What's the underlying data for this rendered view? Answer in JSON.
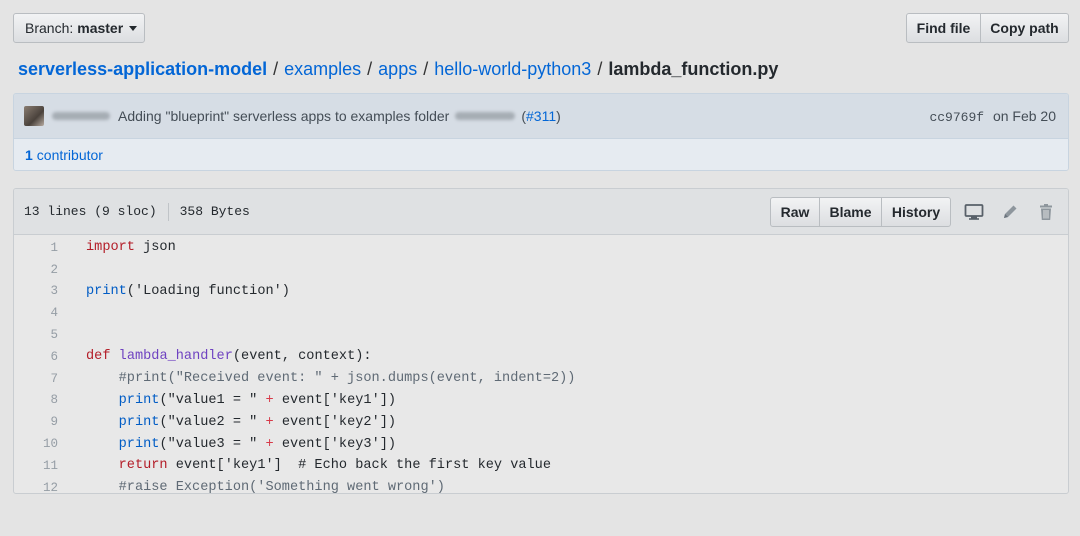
{
  "branch": {
    "label": "Branch:",
    "value": "master"
  },
  "toolbar": {
    "find_file": "Find file",
    "copy_path": "Copy path"
  },
  "breadcrumb": {
    "repo": "serverless-application-model",
    "dirs": [
      "examples",
      "apps",
      "hello-world-python3"
    ],
    "file": "lambda_function.py",
    "separator": "/"
  },
  "commit": {
    "message": "Adding \"blueprint\" serverless apps to examples folder",
    "pr": "#311",
    "pr_open": "(",
    "pr_close": ")",
    "sha": "cc9769f",
    "date": "on Feb 20",
    "contributors_count": "1",
    "contributors_label": "contributor"
  },
  "file": {
    "lines_info": "13 lines (9 sloc)",
    "size": "358 Bytes",
    "raw": "Raw",
    "blame": "Blame",
    "history": "History"
  },
  "icons": {
    "desktop": "desktop-icon",
    "edit": "pencil-icon",
    "delete": "trash-icon"
  },
  "colors": {
    "link": "#0366d6",
    "keyword": "#d73a49",
    "builtin": "#005cc5",
    "function": "#6f42c1",
    "string": "#032f62"
  },
  "code": [
    {
      "n": "1",
      "tokens": [
        {
          "t": "import",
          "c": "kw"
        },
        {
          "t": " json",
          "c": ""
        }
      ]
    },
    {
      "n": "2",
      "tokens": []
    },
    {
      "n": "3",
      "tokens": [
        {
          "t": "print",
          "c": "bi"
        },
        {
          "t": "('Loading function')",
          "c": ""
        }
      ]
    },
    {
      "n": "4",
      "tokens": []
    },
    {
      "n": "5",
      "tokens": []
    },
    {
      "n": "6",
      "tokens": [
        {
          "t": "def",
          "c": "kw"
        },
        {
          "t": " ",
          "c": ""
        },
        {
          "t": "lambda_handler",
          "c": "fn"
        },
        {
          "t": "(event, context):",
          "c": ""
        }
      ]
    },
    {
      "n": "7",
      "tokens": [
        {
          "t": "    #print(\"Received event: \" + json.dumps(event, indent=2))",
          "c": "cm"
        }
      ]
    },
    {
      "n": "8",
      "tokens": [
        {
          "t": "    ",
          "c": ""
        },
        {
          "t": "print",
          "c": "bi"
        },
        {
          "t": "(\"value1 = \" ",
          "c": ""
        },
        {
          "t": "+",
          "c": "kw2"
        },
        {
          "t": " event['key1'])",
          "c": ""
        }
      ]
    },
    {
      "n": "9",
      "tokens": [
        {
          "t": "    ",
          "c": ""
        },
        {
          "t": "print",
          "c": "bi"
        },
        {
          "t": "(\"value2 = \" ",
          "c": ""
        },
        {
          "t": "+",
          "c": "kw2"
        },
        {
          "t": " event['key2'])",
          "c": ""
        }
      ]
    },
    {
      "n": "10",
      "tokens": [
        {
          "t": "    ",
          "c": ""
        },
        {
          "t": "print",
          "c": "bi"
        },
        {
          "t": "(\"value3 = \" ",
          "c": ""
        },
        {
          "t": "+",
          "c": "kw2"
        },
        {
          "t": " event['key3'])",
          "c": ""
        }
      ]
    },
    {
      "n": "11",
      "tokens": [
        {
          "t": "    ",
          "c": ""
        },
        {
          "t": "return",
          "c": "kw"
        },
        {
          "t": " event['key1']  # Echo back the first key value",
          "c": ""
        }
      ]
    },
    {
      "n": "12",
      "tokens": [
        {
          "t": "    #raise Exception('Something went wrong')",
          "c": "cm"
        }
      ]
    }
  ]
}
